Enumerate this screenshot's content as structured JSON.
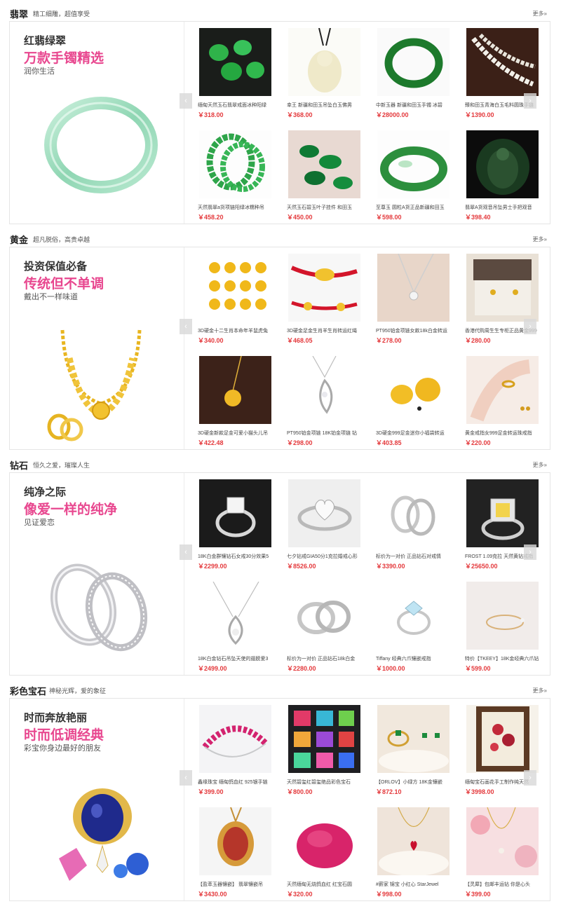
{
  "sections": [
    {
      "title": "翡翠",
      "subtitle": "精工细雕，超值享受",
      "more": "更多»",
      "banner": {
        "line1": "红翡绿翠",
        "line2": "万款手镯精选",
        "line3": "润你生活",
        "image": "jade-bangle"
      },
      "products": [
        {
          "name": "缅甸天然玉石翡翠戒面冰种阳绿",
          "price": "￥318.00",
          "image": "green-cabochons"
        },
        {
          "name": "幸王 新疆和田玉吊坠白玉佛男",
          "price": "￥368.00",
          "image": "jade-buddha-pendant"
        },
        {
          "name": "中新玉器 新疆和田玉手镯 冰碧",
          "price": "￥28000.00",
          "image": "green-bangle"
        },
        {
          "name": "臻和田玉青海白玉毛料圆珠手链",
          "price": "￥1390.00",
          "image": "white-bead-necklace"
        },
        {
          "name": "天然翡翠a货项链阳绿冰糯种吊",
          "price": "￥458.20",
          "image": "green-bead-necklace"
        },
        {
          "name": "天然玉石碧玉叶子挂件 和田玉",
          "price": "￥450.00",
          "image": "green-leaf-pendants"
        },
        {
          "name": "至尊玉 圆粒A货正品新疆和田玉",
          "price": "￥598.00",
          "image": "green-bangle-2"
        },
        {
          "name": "翡翠A货观音吊坠男士手把观音",
          "price": "￥398.40",
          "image": "dark-jade-buddha"
        }
      ]
    },
    {
      "title": "黄金",
      "subtitle": "超凡脱俗，高贵卓越",
      "more": "更多»",
      "banner": {
        "line1": "投资保值必备",
        "line2": "传统但不单调",
        "line3": "戴出不一样味道",
        "image": "gold-necklace"
      },
      "products": [
        {
          "name": "3D硬金十二生肖本命年羊鼠虎兔",
          "price": "￥340.00",
          "image": "gold-zodiac"
        },
        {
          "name": "3D硬金足金生肖羊生肖转运红绳",
          "price": "￥468.05",
          "image": "gold-red-bracelet"
        },
        {
          "name": "PT950铂金项链女款18k白金转运",
          "price": "￥278.00",
          "image": "platinum-pendant"
        },
        {
          "name": "香港代购周生生专柜正品黄金999",
          "price": "￥280.00",
          "image": "gold-earrings-box"
        },
        {
          "name": "3D硬金新款足金可爱小猫头儿吊",
          "price": "￥422.48",
          "image": "gold-pendant"
        },
        {
          "name": "PT950铂金项链 18K铂金项链 钻",
          "price": "￥298.00",
          "image": "silver-pendant"
        },
        {
          "name": "3D硬金999足金迷你小福袋转运",
          "price": "￥403.85",
          "image": "gold-bags"
        },
        {
          "name": "黄金戒指女999足金转运珠戒指",
          "price": "￥220.00",
          "image": "gold-ring-hand"
        }
      ]
    },
    {
      "title": "钻石",
      "subtitle": "恒久之爱，璀璨人生",
      "more": "更多»",
      "banner": {
        "line1": "纯净之际",
        "line2": "像爱一样的纯净",
        "line3": "见证爱恋",
        "image": "wedding-rings"
      },
      "products": [
        {
          "name": "18K白金群镶钻石女戒30分效果5",
          "price": "￥2299.00",
          "image": "diamond-ring-dark"
        },
        {
          "name": "七夕钻戒GIA50分1克拉婚戒心形",
          "price": "￥8526.00",
          "image": "heart-diamond-ring"
        },
        {
          "name": "标价为一对价 正品钻石对戒情",
          "price": "￥3390.00",
          "image": "couple-rings"
        },
        {
          "name": "FROST 1.09克拉 天然黄钻戒指",
          "price": "￥25650.00",
          "image": "yellow-diamond-ring"
        },
        {
          "name": "18K白金钻石吊坠天使的翅膀爱3",
          "price": "￥2499.00",
          "image": "diamond-pendant"
        },
        {
          "name": "标价为一对价 正品钻石18k白金",
          "price": "￥2280.00",
          "image": "couple-rings-2"
        },
        {
          "name": "Tiffany 经典六爪镶嵌戒指",
          "price": "￥1000.00",
          "image": "solitaire-ring"
        },
        {
          "name": "特价【TKEEY】18K金经典六爪钻",
          "price": "￥599.00",
          "image": "thin-gold-ring"
        }
      ]
    },
    {
      "title": "彩色宝石",
      "subtitle": "神秘光辉，爱的象征",
      "more": "更多»",
      "banner": {
        "line1": "时而奔放艳丽",
        "line2": "时而低调经典",
        "line3": "彩宝你身边最好的朋友",
        "image": "gemstone-brooch"
      },
      "products": [
        {
          "name": "鑫缘珠宝 缅甸鸽血红 925银手链",
          "price": "￥399.00",
          "image": "ruby-bracelet"
        },
        {
          "name": "天然碧玺红碧玺绝品彩色宝石",
          "price": "￥800.00",
          "image": "colored-gems-grid"
        },
        {
          "name": "【ORLOV】小绿方 18K金镶嵌",
          "price": "￥872.10",
          "image": "emerald-ring-earrings"
        },
        {
          "name": "缅甸宝石画花手工制作纯天然",
          "price": "￥3998.00",
          "image": "gem-painting"
        },
        {
          "name": "【盈萃玉器镶嵌】 翡翠镶嵌吊",
          "price": "￥3430.00",
          "image": "red-gem-pendant"
        },
        {
          "name": "天然缅甸无烧鸽血红 红宝石圆",
          "price": "￥320.00",
          "image": "ruby-pile"
        },
        {
          "name": "#薪家 锦宝 小红心 StarJewel",
          "price": "￥998.00",
          "image": "red-heart-necklace"
        },
        {
          "name": "【灵犀】包邮丰运钻 你是心头",
          "price": "￥399.00",
          "image": "pink-necklace"
        }
      ]
    }
  ],
  "arrows": {
    "left": "‹",
    "right": "›"
  },
  "colors": {
    "accent_pink": "#e8478f",
    "price_red": "#e4393c",
    "border": "#e5e5e5"
  }
}
